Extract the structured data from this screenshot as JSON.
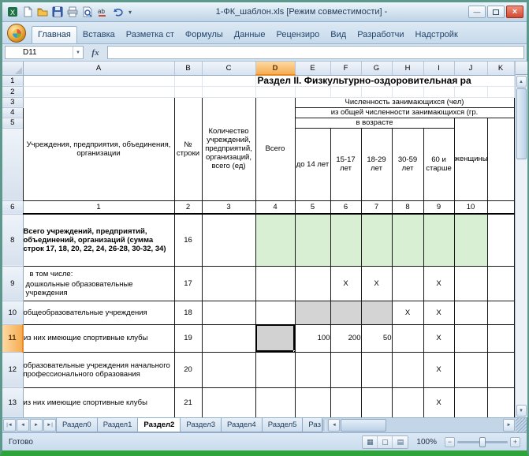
{
  "window": {
    "title": "1-ФК_шаблон.xls [Режим совместимости] -",
    "buttons": {
      "minimize": "—",
      "close": "×"
    }
  },
  "icons": {
    "qat_dropdown": "▾",
    "namebox_dropdown": "▼",
    "scroll_up": "▲",
    "scroll_down": "▼",
    "tab_first": "|◄",
    "tab_prev": "◄",
    "tab_next": "►",
    "tab_last": "►|",
    "hscroll_left": "◄",
    "hscroll_right": "►",
    "view_normal": "▦",
    "view_layout": "▢",
    "view_break": "▤",
    "zoom_out": "−",
    "zoom_in": "+"
  },
  "ribbon": {
    "tabs": [
      "Главная",
      "Вставка",
      "Разметка ст",
      "Формулы",
      "Данные",
      "Рецензиро",
      "Вид",
      "Разработчи",
      "Надстройк"
    ],
    "active_tab": "Главная"
  },
  "formula_bar": {
    "name_box_value": "D11",
    "fx_label": "fx",
    "formula_value": ""
  },
  "grid": {
    "column_headers": [
      "A",
      "B",
      "C",
      "D",
      "E",
      "F",
      "G",
      "H",
      "I",
      "J",
      "K"
    ],
    "selected_column": "D",
    "row_numbers": [
      "1",
      "2",
      "3",
      "4",
      "5",
      "6",
      "8",
      "9",
      "10",
      "11",
      "12",
      "13"
    ],
    "selected_row": "11",
    "active_cell": "D11",
    "status_colors": {
      "green_fill": "#d9efd3",
      "gray_fill": "#d4d4d4",
      "selection_orange": "#f6ad52",
      "entry_blue": "#2525cc"
    }
  },
  "sheet": {
    "section_title": "Раздел II. Физкультурно-оздоровительная ра",
    "header": {
      "organizations": "Учреждения, предприятия, объединения, организации",
      "line_no": "№ строки",
      "org_count": "Количество учреждений, предприятий, организаций, всего (ед)",
      "total": "Всего",
      "group_top": "Численность занимающихся (чел)",
      "group_mid": "из общей численности занимающихся (гр.",
      "group_age": "в возрасте",
      "age_columns": [
        "до 14 лет",
        "15-17 лет",
        "18-29 лет",
        "30-59 лет",
        "60 и старше"
      ],
      "women": "женщины",
      "column_numbers": [
        "1",
        "2",
        "3",
        "4",
        "5",
        "6",
        "7",
        "8",
        "9",
        "10"
      ]
    },
    "body": [
      {
        "label": "Всего учреждений, предприятий, объединений, организаций (сумма строк 17, 18, 20, 22, 24, 26-28, 30-32, 34)",
        "line": "16"
      },
      {
        "prefix": "в том числе:",
        "label": "дошкольные образовательные учреждения",
        "line": "17",
        "F": "X",
        "G": "X",
        "I": "X"
      },
      {
        "label": "общеобразовательные учреждения",
        "line": "18",
        "H": "X",
        "I": "X"
      },
      {
        "label": "из них имеющие спортивные клубы",
        "line": "19",
        "E": "100",
        "F": "200",
        "G": "50",
        "I": "X"
      },
      {
        "label": "образовательные учреждения начального профессионального образования",
        "line": "20",
        "I": "X"
      },
      {
        "label": "из них имеющие спортивные клубы",
        "line": "21",
        "I": "X"
      }
    ]
  },
  "sheet_tabs": {
    "items": [
      "Раздел0",
      "Раздел1",
      "Раздел2",
      "Раздел3",
      "Раздел4",
      "Раздел5",
      "Раз"
    ],
    "active": "Раздел2"
  },
  "status_bar": {
    "ready": "Готово",
    "zoom": "100%"
  }
}
